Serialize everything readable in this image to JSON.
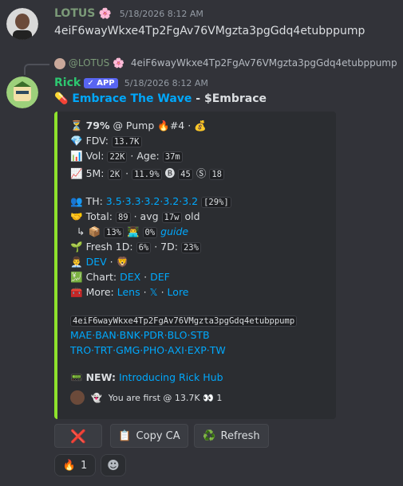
{
  "msg1": {
    "username": "LOTUS",
    "badge_emoji": "🌸",
    "timestamp": "5/18/2026 8:12 AM",
    "content": "4eiF6wayWkxe4Tp2FgAv76VMgzta3pgGdq4etubppump"
  },
  "reply": {
    "username": "@LOTUS",
    "badge_emoji": "🌸",
    "content": "4eiF6wayWkxe4Tp2FgAv76VMgzta3pgGdq4etubppump"
  },
  "msg2": {
    "username": "Rick",
    "app_badge": "APP",
    "timestamp": "5/18/2026 8:12 AM",
    "pill_emoji": "💊",
    "title_link": "Embrace The Wave",
    "title_suffix": " - $Embrace"
  },
  "embed": {
    "l1_icon": "⏳",
    "l1_pct": "79%",
    "l1_rest": " @ Pump 🔥#4 · 💰",
    "fdv_icon": "💎",
    "fdv_label": "FDV:",
    "fdv_val": "13.7K",
    "vol_icon": "📊",
    "vol_label": "Vol:",
    "vol_val": "22K",
    "age_label": "· Age:",
    "age_val": "37m",
    "m5_icon": "📈",
    "m5_label": "5M:",
    "m5_val1": "2K",
    "m5_val2": "11.9%",
    "m5_b": "🅑",
    "m5_val3": "45",
    "m5_s": "Ⓢ",
    "m5_val4": "18",
    "th_icon": "👥",
    "th_label": "TH:",
    "th_links": "3.5·3.3·3.2·3.2·3.2",
    "th_pct": "[29%]",
    "total_icon": "🤝",
    "total_label": "Total:",
    "total_val": "89",
    "avg_label": "· avg",
    "avg_val": "17w",
    "old_label": "old",
    "sub_icon": "↳ 📦",
    "sub_val1": "13%",
    "sub_icon2": "👨‍💻",
    "sub_val2": "0%",
    "guide": "guide",
    "fresh_icon": "🌱",
    "fresh_label": "Fresh 1D:",
    "fresh_val": "6%",
    "fresh7_label": "· 7D:",
    "fresh7_val": "23%",
    "dev_icon": "👨‍💼",
    "dev_link": "DEV",
    "dev_suffix": " · 🦁",
    "chart_icon": "💹",
    "chart_label": "Chart:",
    "chart_dex": "DEX",
    "chart_def": "DEF",
    "more_icon": "🧰",
    "more_label": "More:",
    "more_lens": "Lens",
    "more_x": "𝕏",
    "more_lore": "Lore",
    "ca": "4eiF6wayWkxe4Tp2FgAv76VMgzta3pgGdq4etubppump",
    "links1": "MAE·BAN·BNK·PDR·BLO·STB",
    "links2": "TRO·TRT·GMG·PHO·AXI·EXP·TW",
    "new_icon": "📟",
    "new_label": "NEW:",
    "new_link": "Introducing Rick Hub",
    "footer_icon": "👻",
    "footer_text": "You are first @ 13.7K 👀 1"
  },
  "buttons": {
    "close": "❌",
    "copy_icon": "📋",
    "copy": "Copy CA",
    "refresh_icon": "♻️",
    "refresh": "Refresh"
  },
  "reactions": {
    "fire": "🔥",
    "fire_count": "1",
    "add": "☻"
  },
  "colors": {
    "lotus_green": "#7b9a78",
    "rick_green": "#2dc770",
    "link": "#00a8fc",
    "embed_bar": "#8ee22c"
  }
}
